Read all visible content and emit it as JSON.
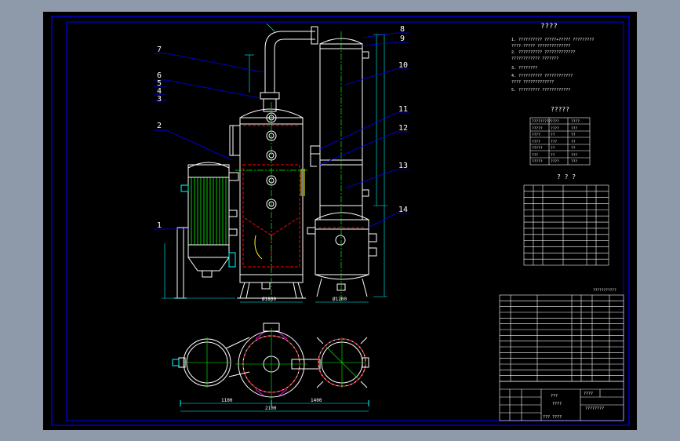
{
  "viewport": {
    "background": "#8e9aaa",
    "drawing_background": "#000000"
  },
  "colors": {
    "frame": "#0000ff",
    "outline": "#ffffff",
    "centerline": "#00ff00",
    "hidden": "#ff0000",
    "dimension": "#00ffff",
    "highlight": "#ffff00",
    "accent": "#ff00ff"
  },
  "callouts": [
    {
      "id": "1",
      "label": "1"
    },
    {
      "id": "2",
      "label": "2"
    },
    {
      "id": "3",
      "label": "3"
    },
    {
      "id": "4",
      "label": "4"
    },
    {
      "id": "5",
      "label": "5"
    },
    {
      "id": "6",
      "label": "6"
    },
    {
      "id": "7",
      "label": "7"
    },
    {
      "id": "8",
      "label": "8"
    },
    {
      "id": "9",
      "label": "9"
    },
    {
      "id": "10",
      "label": "10"
    },
    {
      "id": "11",
      "label": "11"
    },
    {
      "id": "12",
      "label": "12"
    },
    {
      "id": "13",
      "label": "13"
    },
    {
      "id": "14",
      "label": "14"
    }
  ],
  "notes": {
    "title": "????",
    "lines": [
      "1. ?????????? ?????+????? ?????????",
      "   ????-????? ??????????????",
      "2. ?????????? ?????????????",
      "   ???????????? ???????",
      "3. ????????",
      "4. ?????????? ????????????",
      "   ???? ?????????????",
      "5. ????????? ????????????"
    ]
  },
  "tech_table": {
    "title": "?????",
    "rows": [
      [
        "?????????",
        "????",
        "????"
      ],
      [
        "?????",
        "????",
        "???"
      ],
      [
        "????",
        "??",
        "??"
      ],
      [
        "????",
        "???",
        "??"
      ],
      [
        "?????",
        "??",
        "??"
      ],
      [
        "???",
        "??",
        "???"
      ],
      [
        "?????",
        "????",
        "???"
      ]
    ]
  },
  "nozzle_table": {
    "title": "? ? ?",
    "rows": 13
  },
  "small_label": "???????????",
  "parts_list_rows": 15,
  "title_block": {
    "label_a": "???",
    "label_b": "????",
    "drawing_name": "????????",
    "label_c": "????",
    "footer": "??? ????"
  },
  "dimensions": {
    "bottom_left": "1100",
    "bottom_total": "2100",
    "bottom_right": "1400",
    "base_left": "Ø1800",
    "base_right": "Ø1200"
  }
}
